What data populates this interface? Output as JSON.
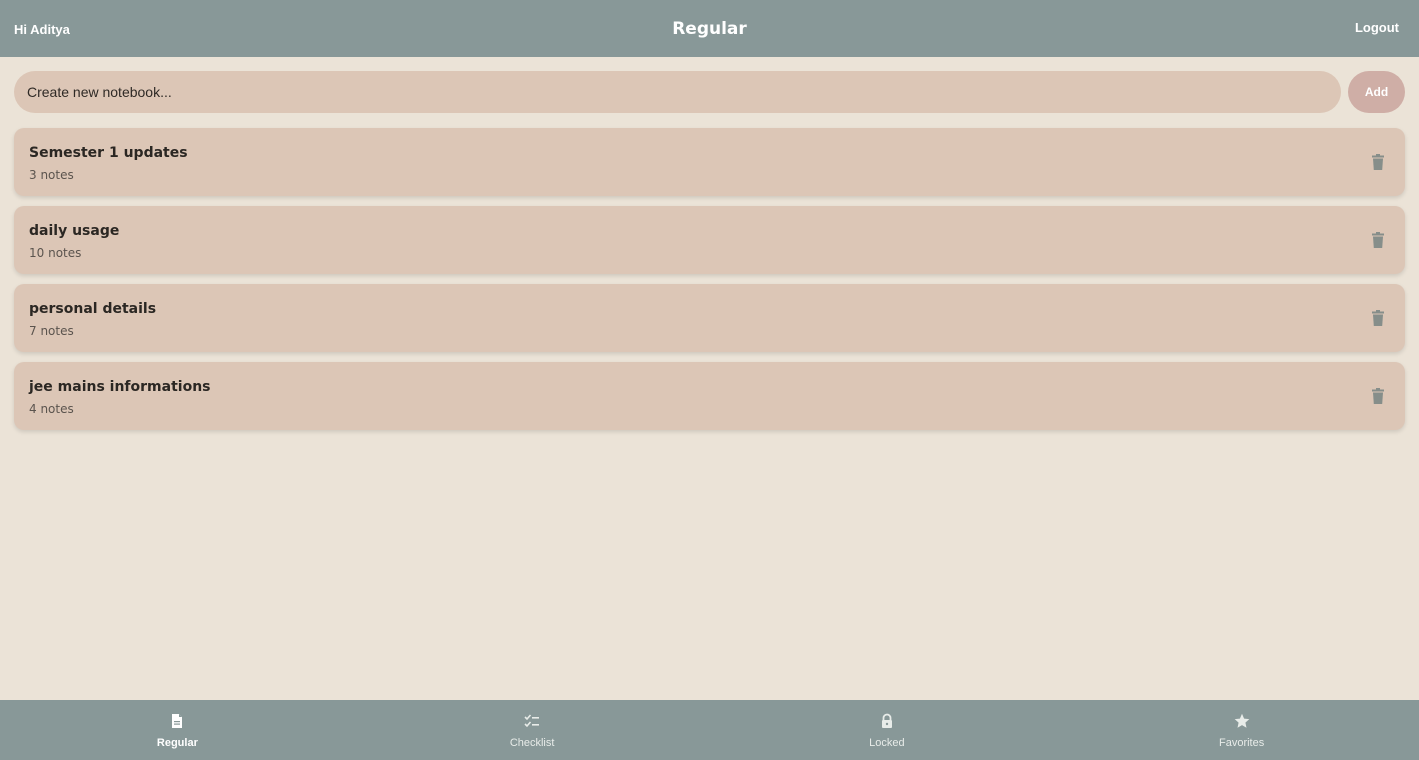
{
  "header": {
    "greeting": "Hi Aditya",
    "title": "Regular",
    "logout_label": "Logout"
  },
  "create": {
    "placeholder": "Create new notebook...",
    "add_label": "Add"
  },
  "notebooks": [
    {
      "name": "Semester 1 updates",
      "count": "3 notes"
    },
    {
      "name": "daily usage",
      "count": "10 notes"
    },
    {
      "name": "personal details",
      "count": "7 notes"
    },
    {
      "name": "jee mains informations",
      "count": "4 notes"
    }
  ],
  "nav": [
    {
      "label": "Regular",
      "icon": "document-icon",
      "active": true
    },
    {
      "label": "Checklist",
      "icon": "checklist-icon",
      "active": false
    },
    {
      "label": "Locked",
      "icon": "lock-icon",
      "active": false
    },
    {
      "label": "Favorites",
      "icon": "star-icon",
      "active": false
    }
  ],
  "colors": {
    "header_bg": "#889898",
    "page_bg": "#ebe3d7",
    "card_bg": "#dcc6b6",
    "add_button_bg": "#cfaea6"
  }
}
